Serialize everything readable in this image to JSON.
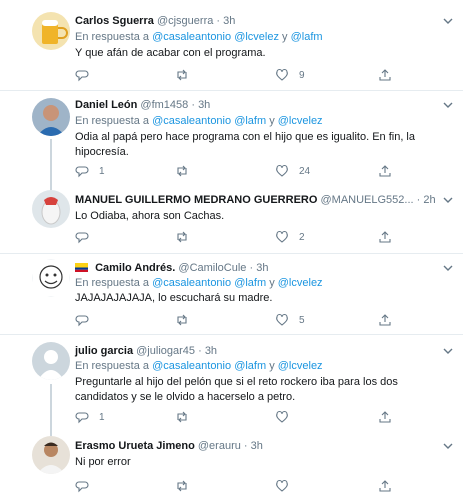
{
  "tweets": [
    {
      "name": "Carlos Sguerra",
      "handle": "@cjsguerra",
      "time": "3h",
      "reply_prefix": "En respuesta a",
      "reply_mentions": [
        "@casaleantonio",
        "@lcvelez",
        "@lafm"
      ],
      "text": "Y que afán de acabar con el programa.",
      "counts": {
        "reply": "",
        "retweet": "",
        "like": "9"
      }
    },
    {
      "name": "Daniel León",
      "handle": "@fm1458",
      "time": "3h",
      "reply_prefix": "En respuesta a",
      "reply_mentions": [
        "@casaleantonio",
        "@lafm",
        "@lcvelez"
      ],
      "text": "Odia al papá pero hace programa con el hijo que es igualito. En fin, la hipocresía.",
      "counts": {
        "reply": "1",
        "retweet": "",
        "like": "24"
      }
    },
    {
      "name": "MANUEL GUILLERMO MEDRANO GUERRERO",
      "handle": "@MANUELG552...",
      "time": "2h",
      "text": "Lo Odiaba, ahora son Cachas.",
      "counts": {
        "reply": "",
        "retweet": "",
        "like": "2"
      }
    },
    {
      "name": "Camilo Andrés.",
      "handle": "@CamiloCule",
      "time": "3h",
      "reply_prefix": "En respuesta a",
      "reply_mentions": [
        "@casaleantonio",
        "@lafm",
        "@lcvelez"
      ],
      "text": "JAJAJAJAJAJA, lo escuchará su madre.",
      "counts": {
        "reply": "",
        "retweet": "",
        "like": "5"
      }
    },
    {
      "name": "julio garcia",
      "handle": "@juliogar45",
      "time": "3h",
      "reply_prefix": "En respuesta a",
      "reply_mentions": [
        "@casaleantonio",
        "@lafm",
        "@lcvelez"
      ],
      "text": "Preguntarle al hijo del pelón que si el reto rockero iba para los dos candidatos y se le olvido a hacerselo a petro.",
      "counts": {
        "reply": "1",
        "retweet": "",
        "like": ""
      }
    },
    {
      "name": "Erasmo Urueta Jimeno",
      "handle": "@erauru",
      "time": "3h",
      "text": "Ni por error",
      "counts": {
        "reply": "",
        "retweet": "",
        "like": ""
      }
    }
  ],
  "separator_dot": "·",
  "conjunction": "y",
  "colors": {
    "link": "#1b95e0",
    "muted": "#657786",
    "border": "#e6ecf0",
    "thread": "#ccd6dd"
  },
  "icons": [
    "reply-icon",
    "retweet-icon",
    "like-icon",
    "share-icon",
    "chevron-down-icon"
  ]
}
